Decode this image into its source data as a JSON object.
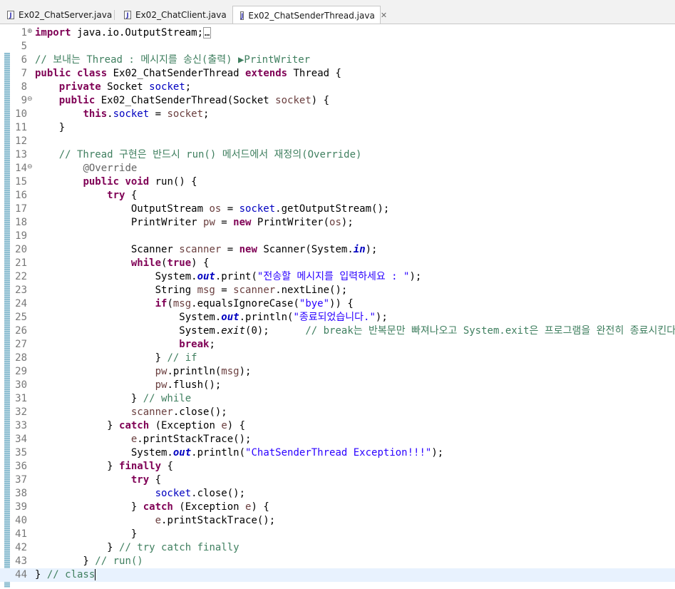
{
  "tabs": [
    {
      "name": "Ex02_ChatServer.java",
      "active": false
    },
    {
      "name": "Ex02_ChatClient.java",
      "active": false
    },
    {
      "name": "Ex02_ChatSenderThread.java",
      "active": true
    }
  ],
  "close_glyph": "✕",
  "file_icon_glyph": "J",
  "colors": {
    "keyword": "#7f0055",
    "comment": "#3f7f5f",
    "string": "#2a00ff",
    "field": "#0000c0",
    "annotation": "#646464",
    "line_number": "#787878",
    "current_line": "#e8f2fe"
  },
  "current_line": 44,
  "lines": [
    {
      "num": "1",
      "fold": "⊕",
      "tokens": [
        [
          "k",
          "import"
        ],
        [
          "p",
          " java.io.OutputStream;"
        ],
        [
          "x",
          "…"
        ]
      ]
    },
    {
      "num": "5",
      "tokens": []
    },
    {
      "num": "6",
      "tokens": [
        [
          "c",
          "// 보내는 Thread : 메시지를 송신(출력) ▶PrintWriter"
        ]
      ]
    },
    {
      "num": "7",
      "tokens": [
        [
          "k",
          "public"
        ],
        [
          "p",
          " "
        ],
        [
          "k",
          "class"
        ],
        [
          "p",
          " Ex02_ChatSenderThread "
        ],
        [
          "k",
          "extends"
        ],
        [
          "p",
          " Thread {"
        ]
      ]
    },
    {
      "num": "8",
      "tokens": [
        [
          "p",
          "    "
        ],
        [
          "k",
          "private"
        ],
        [
          "p",
          " Socket "
        ],
        [
          "f",
          "socket"
        ],
        [
          "p",
          ";"
        ]
      ]
    },
    {
      "num": "9",
      "fold": "⊖",
      "tokens": [
        [
          "p",
          "    "
        ],
        [
          "k",
          "public"
        ],
        [
          "p",
          " Ex02_ChatSenderThread(Socket "
        ],
        [
          "l",
          "socket"
        ],
        [
          "p",
          ") {"
        ]
      ]
    },
    {
      "num": "10",
      "tokens": [
        [
          "p",
          "        "
        ],
        [
          "k",
          "this"
        ],
        [
          "p",
          "."
        ],
        [
          "f",
          "socket"
        ],
        [
          "p",
          " = "
        ],
        [
          "l",
          "socket"
        ],
        [
          "p",
          ";"
        ]
      ]
    },
    {
      "num": "11",
      "tokens": [
        [
          "p",
          "    }"
        ]
      ]
    },
    {
      "num": "12",
      "tokens": []
    },
    {
      "num": "13",
      "tokens": [
        [
          "p",
          "    "
        ],
        [
          "c",
          "// Thread 구현은 반드시 run() 메서드에서 재정의(Override)"
        ]
      ]
    },
    {
      "num": "14",
      "fold": "⊖",
      "tokens": [
        [
          "p",
          "        "
        ],
        [
          "a",
          "@Override"
        ]
      ]
    },
    {
      "num": "15",
      "tokens": [
        [
          "p",
          "        "
        ],
        [
          "k",
          "public"
        ],
        [
          "p",
          " "
        ],
        [
          "k",
          "void"
        ],
        [
          "p",
          " run() {"
        ]
      ]
    },
    {
      "num": "16",
      "tokens": [
        [
          "p",
          "            "
        ],
        [
          "k",
          "try"
        ],
        [
          "p",
          " {"
        ]
      ]
    },
    {
      "num": "17",
      "tokens": [
        [
          "p",
          "                OutputStream "
        ],
        [
          "l",
          "os"
        ],
        [
          "p",
          " = "
        ],
        [
          "f",
          "socket"
        ],
        [
          "p",
          ".getOutputStream();"
        ]
      ]
    },
    {
      "num": "18",
      "tokens": [
        [
          "p",
          "                PrintWriter "
        ],
        [
          "l",
          "pw"
        ],
        [
          "p",
          " = "
        ],
        [
          "k",
          "new"
        ],
        [
          "p",
          " PrintWriter("
        ],
        [
          "l",
          "os"
        ],
        [
          "p",
          ");"
        ]
      ]
    },
    {
      "num": "19",
      "tokens": []
    },
    {
      "num": "20",
      "tokens": [
        [
          "p",
          "                Scanner "
        ],
        [
          "l",
          "scanner"
        ],
        [
          "p",
          " = "
        ],
        [
          "k",
          "new"
        ],
        [
          "p",
          " Scanner(System."
        ],
        [
          "fi",
          "in"
        ],
        [
          "p",
          ");"
        ]
      ]
    },
    {
      "num": "21",
      "tokens": [
        [
          "p",
          "                "
        ],
        [
          "k",
          "while"
        ],
        [
          "p",
          "("
        ],
        [
          "k",
          "true"
        ],
        [
          "p",
          ") {"
        ]
      ]
    },
    {
      "num": "22",
      "tokens": [
        [
          "p",
          "                    System."
        ],
        [
          "fi",
          "out"
        ],
        [
          "p",
          ".print("
        ],
        [
          "s",
          "\"전송할 메시지를 입력하세요 : \""
        ],
        [
          "p",
          ");"
        ]
      ]
    },
    {
      "num": "23",
      "tokens": [
        [
          "p",
          "                    String "
        ],
        [
          "l",
          "msg"
        ],
        [
          "p",
          " = "
        ],
        [
          "l",
          "scanner"
        ],
        [
          "p",
          ".nextLine();"
        ]
      ]
    },
    {
      "num": "24",
      "tokens": [
        [
          "p",
          "                    "
        ],
        [
          "k",
          "if"
        ],
        [
          "p",
          "("
        ],
        [
          "l",
          "msg"
        ],
        [
          "p",
          ".equalsIgnoreCase("
        ],
        [
          "s",
          "\"bye\""
        ],
        [
          "p",
          ")) {"
        ]
      ]
    },
    {
      "num": "25",
      "tokens": [
        [
          "p",
          "                        System."
        ],
        [
          "fi",
          "out"
        ],
        [
          "p",
          ".println("
        ],
        [
          "s",
          "\"종료되었습니다.\""
        ],
        [
          "p",
          ");"
        ]
      ]
    },
    {
      "num": "26",
      "tokens": [
        [
          "p",
          "                        System."
        ],
        [
          "m",
          "exit"
        ],
        [
          "p",
          "(0);      "
        ],
        [
          "c",
          "// break는 반복문만 빠져나오고 System.exit은 프로그램을 완전히 종료시킨다."
        ]
      ]
    },
    {
      "num": "27",
      "tokens": [
        [
          "p",
          "                        "
        ],
        [
          "k",
          "break"
        ],
        [
          "p",
          ";"
        ]
      ]
    },
    {
      "num": "28",
      "tokens": [
        [
          "p",
          "                    } "
        ],
        [
          "c",
          "// if"
        ]
      ]
    },
    {
      "num": "29",
      "tokens": [
        [
          "p",
          "                    "
        ],
        [
          "l",
          "pw"
        ],
        [
          "p",
          ".println("
        ],
        [
          "l",
          "msg"
        ],
        [
          "p",
          ");"
        ]
      ]
    },
    {
      "num": "30",
      "tokens": [
        [
          "p",
          "                    "
        ],
        [
          "l",
          "pw"
        ],
        [
          "p",
          ".flush();"
        ]
      ]
    },
    {
      "num": "31",
      "tokens": [
        [
          "p",
          "                } "
        ],
        [
          "c",
          "// while"
        ]
      ]
    },
    {
      "num": "32",
      "tokens": [
        [
          "p",
          "                "
        ],
        [
          "l",
          "scanner"
        ],
        [
          "p",
          ".close();"
        ]
      ]
    },
    {
      "num": "33",
      "tokens": [
        [
          "p",
          "            } "
        ],
        [
          "k",
          "catch"
        ],
        [
          "p",
          " (Exception "
        ],
        [
          "l",
          "e"
        ],
        [
          "p",
          ") {"
        ]
      ]
    },
    {
      "num": "34",
      "tokens": [
        [
          "p",
          "                "
        ],
        [
          "l",
          "e"
        ],
        [
          "p",
          ".printStackTrace();"
        ]
      ]
    },
    {
      "num": "35",
      "tokens": [
        [
          "p",
          "                System."
        ],
        [
          "fi",
          "out"
        ],
        [
          "p",
          ".println("
        ],
        [
          "s",
          "\"ChatSenderThread Exception!!!\""
        ],
        [
          "p",
          ");"
        ]
      ]
    },
    {
      "num": "36",
      "tokens": [
        [
          "p",
          "            } "
        ],
        [
          "k",
          "finally"
        ],
        [
          "p",
          " {"
        ]
      ]
    },
    {
      "num": "37",
      "tokens": [
        [
          "p",
          "                "
        ],
        [
          "k",
          "try"
        ],
        [
          "p",
          " {"
        ]
      ]
    },
    {
      "num": "38",
      "tokens": [
        [
          "p",
          "                    "
        ],
        [
          "f",
          "socket"
        ],
        [
          "p",
          ".close();"
        ]
      ]
    },
    {
      "num": "39",
      "tokens": [
        [
          "p",
          "                } "
        ],
        [
          "k",
          "catch"
        ],
        [
          "p",
          " (Exception "
        ],
        [
          "l",
          "e"
        ],
        [
          "p",
          ") {"
        ]
      ]
    },
    {
      "num": "40",
      "tokens": [
        [
          "p",
          "                    "
        ],
        [
          "l",
          "e"
        ],
        [
          "p",
          ".printStackTrace();"
        ]
      ]
    },
    {
      "num": "41",
      "tokens": [
        [
          "p",
          "                }"
        ]
      ]
    },
    {
      "num": "42",
      "tokens": [
        [
          "p",
          "            } "
        ],
        [
          "c",
          "// try catch finally"
        ]
      ]
    },
    {
      "num": "43",
      "tokens": [
        [
          "p",
          "        } "
        ],
        [
          "c",
          "// run()"
        ]
      ]
    },
    {
      "num": "44",
      "tokens": [
        [
          "p",
          "} "
        ],
        [
          "c",
          "// class"
        ]
      ]
    }
  ]
}
